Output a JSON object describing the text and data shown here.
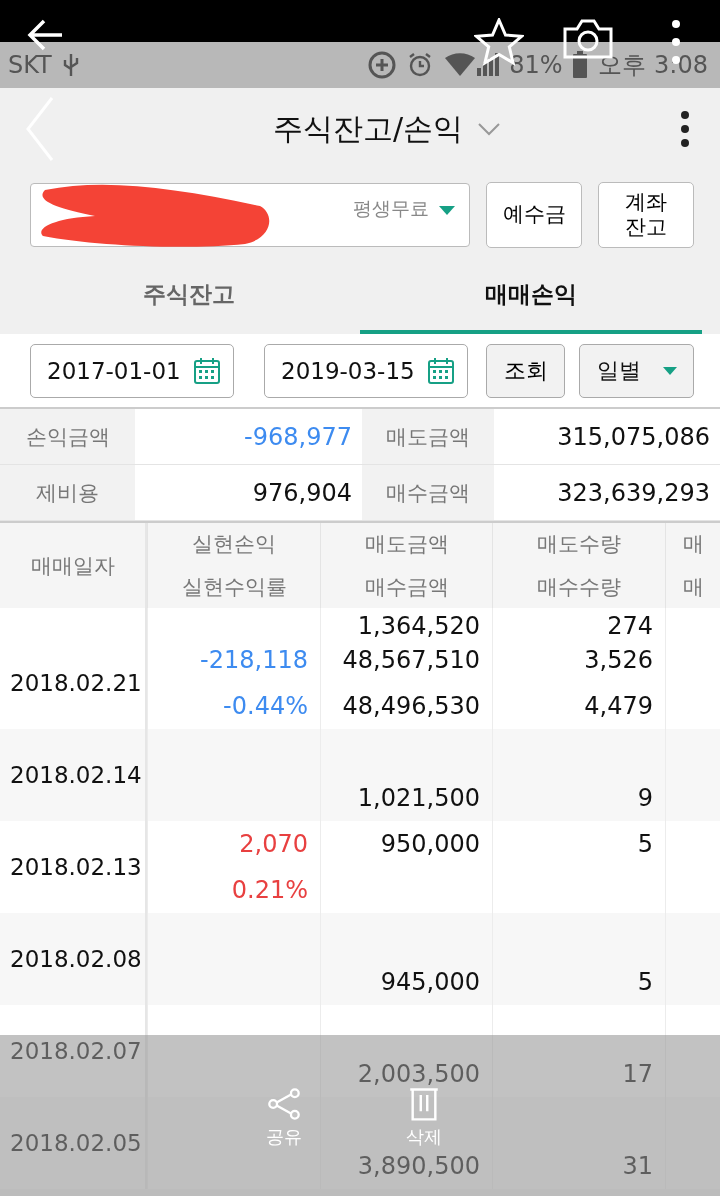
{
  "status_bar": {
    "carrier": "SKT",
    "battery": "81%",
    "time": "오후 3:08"
  },
  "header": {
    "title": "주식잔고/손익"
  },
  "account": {
    "badge": "평생무료"
  },
  "account_buttons": [
    "예수금",
    "계좌 잔고"
  ],
  "tabs": [
    {
      "label": "주식잔고",
      "selected": false
    },
    {
      "label": "매매손익",
      "selected": true
    }
  ],
  "filter": {
    "start_date": "2017-01-01",
    "end_date": "2019-03-15",
    "search_button": "조회",
    "period": "일별"
  },
  "summary": [
    {
      "label": "손익금액",
      "value": "-968,977",
      "color": "#3d8bf0"
    },
    {
      "label": "매도금액",
      "value": "315,075,086"
    },
    {
      "label": "제비용",
      "value": "976,904"
    },
    {
      "label": "매수금액",
      "value": "323,639,293"
    }
  ],
  "table": {
    "columns": [
      {
        "top": "매매일자"
      },
      {
        "top": "실현손익",
        "bottom": "실현수익률"
      },
      {
        "top": "매도금액",
        "bottom": "매수금액"
      },
      {
        "top": "매도수량",
        "bottom": "매수수량"
      },
      {
        "top": "매",
        "bottom": "매"
      }
    ],
    "rows": [
      {
        "partial": true,
        "buy_amount": "1,364,520",
        "buy_qty": "274"
      },
      {
        "date": "2018.02.21",
        "profit": "-218,118",
        "rate": "-0.44%",
        "color": "#3d8bf0",
        "sell_amount": "48,567,510",
        "buy_amount": "48,496,530",
        "sell_qty": "3,526",
        "buy_qty": "4,479"
      },
      {
        "date": "2018.02.14",
        "buy_amount": "1,021,500",
        "buy_qty": "9"
      },
      {
        "date": "2018.02.13",
        "profit": "2,070",
        "rate": "0.21%",
        "color": "#e84040",
        "sell_amount": "950,000",
        "sell_qty": "5"
      },
      {
        "date": "2018.02.08",
        "buy_amount": "945,000",
        "buy_qty": "5"
      },
      {
        "date": "2018.02.07",
        "buy_amount": "2,003,500",
        "buy_qty": "17"
      },
      {
        "date": "2018.02.05",
        "buy_amount": "3,890,500",
        "buy_qty": "31"
      }
    ]
  },
  "action_bar": {
    "actions": [
      {
        "kind": "share",
        "label": "공유"
      },
      {
        "kind": "delete",
        "label": "삭제"
      }
    ]
  }
}
